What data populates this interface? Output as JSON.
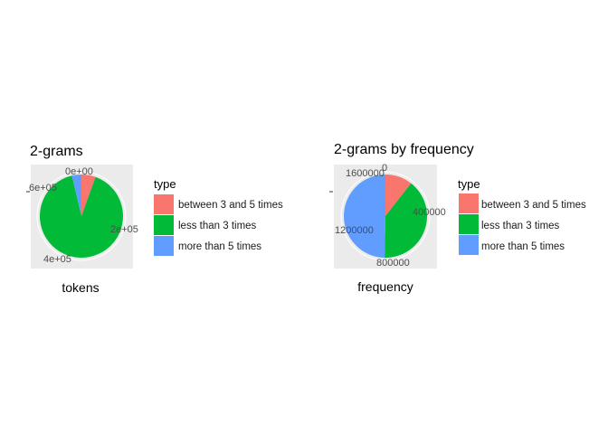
{
  "chart_data": [
    {
      "type": "pie",
      "title": "2-grams",
      "xlabel": "tokens",
      "ylabel": "",
      "legend_title": "type",
      "legend_position": "right",
      "ticks": [
        "0e+00",
        "2e+05",
        "4e+05",
        "6e+05"
      ],
      "axis_max": 800000,
      "categories": [
        "between 3 and 5 times",
        "less than 3 times",
        "more than 5 times"
      ],
      "values": [
        45000,
        740000,
        30000
      ],
      "colors": [
        "#F8766D",
        "#00BA38",
        "#619CFF"
      ],
      "grid": true
    },
    {
      "type": "pie",
      "title": "2-grams by frequency",
      "xlabel": "frequency",
      "ylabel": "",
      "legend_title": "type",
      "legend_position": "right",
      "ticks": [
        "0",
        "400000",
        "800000",
        "1200000",
        "1600000"
      ],
      "axis_max": 1600000,
      "categories": [
        "between 3 and 5 times",
        "less than 3 times",
        "more than 5 times"
      ],
      "values": [
        170000,
        640000,
        800000
      ],
      "colors": [
        "#F8766D",
        "#00BA38",
        "#619CFF"
      ],
      "grid": true
    }
  ]
}
